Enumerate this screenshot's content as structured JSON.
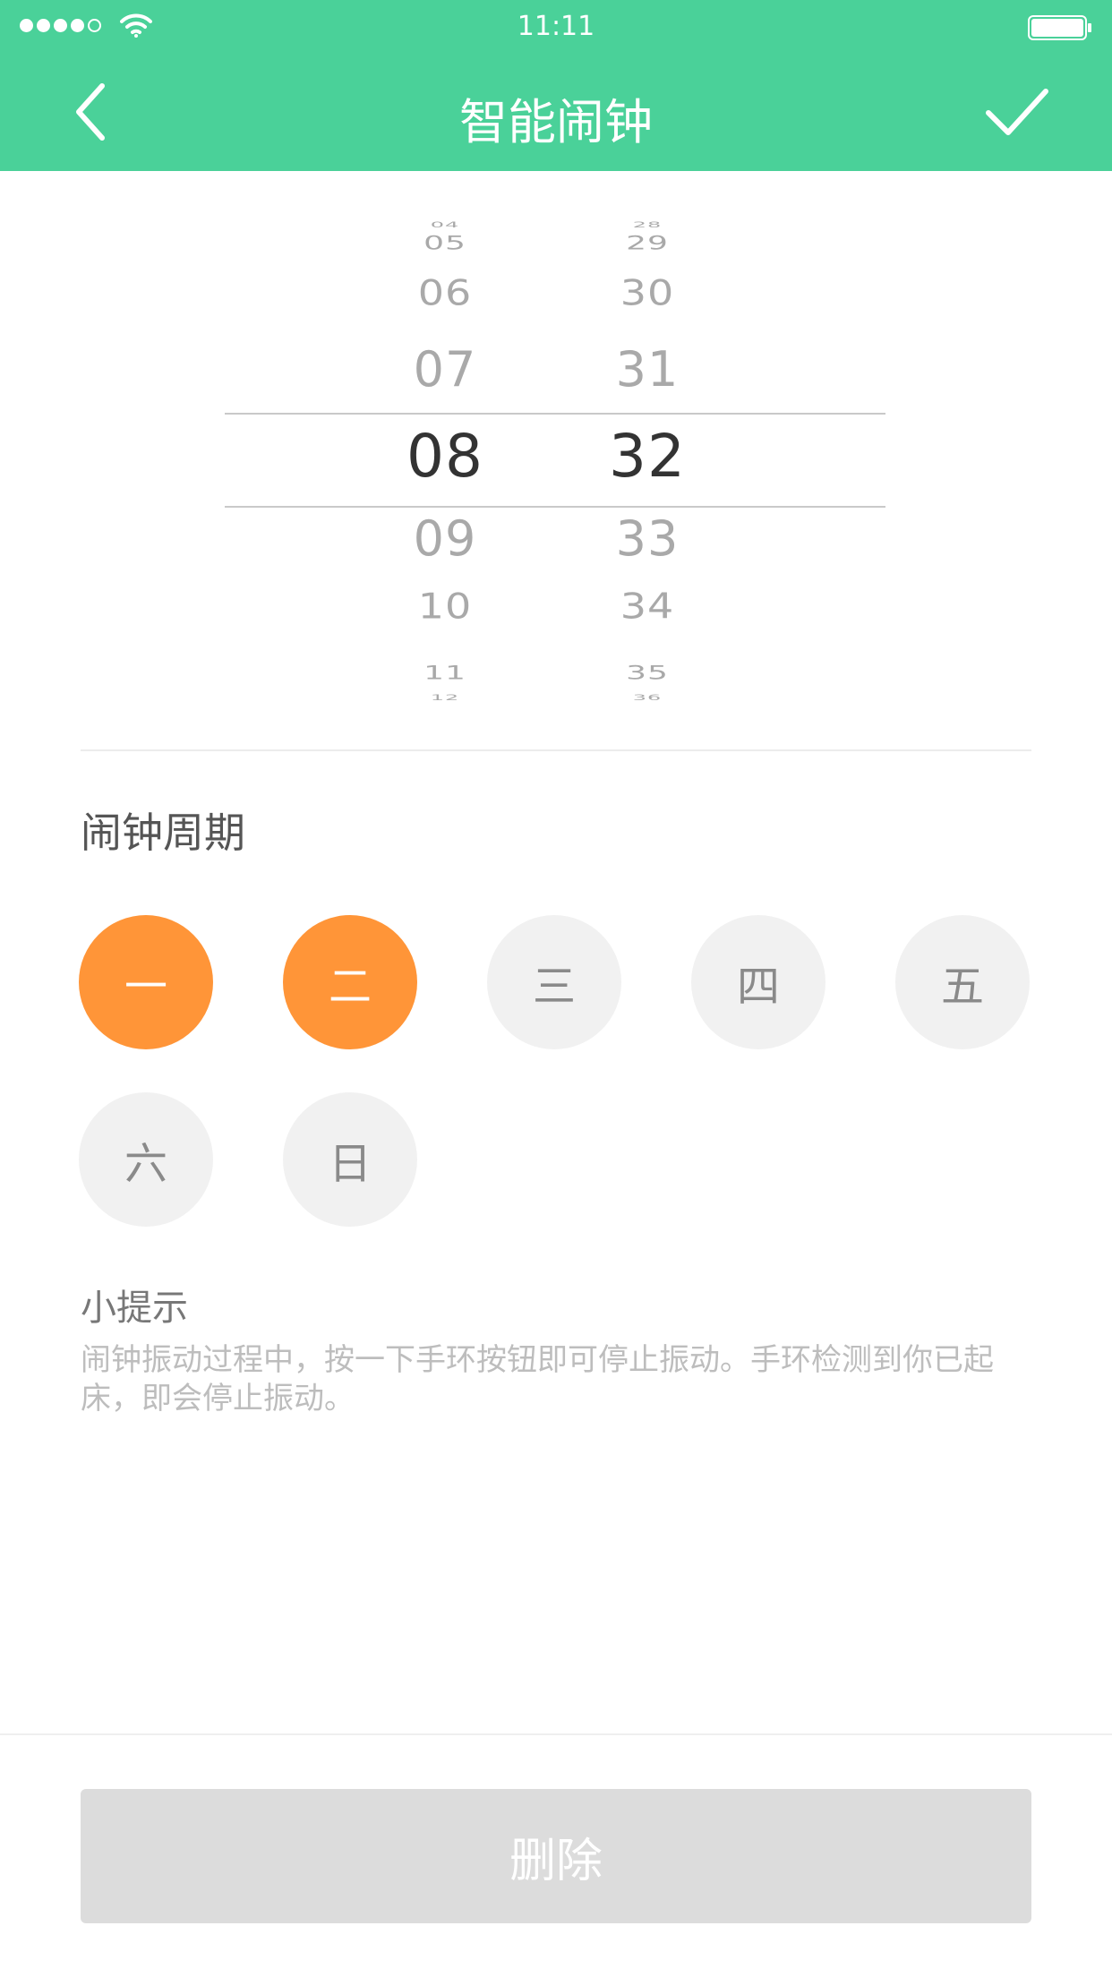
{
  "status_bar": {
    "time": "11:11",
    "signal_bars": 4,
    "signal_total": 5,
    "wifi_icon": "wifi-icon",
    "battery_icon": "battery-full-icon",
    "battery_level": 1.0
  },
  "nav": {
    "back_icon": "chevron-left-icon",
    "title": "智能闹钟",
    "done_icon": "checkmark-icon"
  },
  "picker": {
    "hours": [
      "04",
      "05",
      "06",
      "07",
      "08",
      "09",
      "10",
      "11",
      "12"
    ],
    "minutes": [
      "28",
      "29",
      "30",
      "31",
      "32",
      "33",
      "34",
      "35",
      "36"
    ],
    "selected_hour": "08",
    "selected_minute": "32"
  },
  "period": {
    "title": "闹钟周期",
    "days": [
      {
        "label": "一",
        "selected": true
      },
      {
        "label": "二",
        "selected": true
      },
      {
        "label": "三",
        "selected": false
      },
      {
        "label": "四",
        "selected": false
      },
      {
        "label": "五",
        "selected": false
      },
      {
        "label": "六",
        "selected": false
      },
      {
        "label": "日",
        "selected": false
      }
    ]
  },
  "tip": {
    "title": "小提示",
    "text": "闹钟振动过程中，按一下手环按钮即可停止振动。手环检测到你已起床，即会停止振动。"
  },
  "delete_button": {
    "label": "删除"
  },
  "colors": {
    "header": "#4ad199",
    "day_selected": "#ff9538",
    "day_unselected": "#f1f1f1",
    "delete_bg": "#dcdcdc"
  }
}
